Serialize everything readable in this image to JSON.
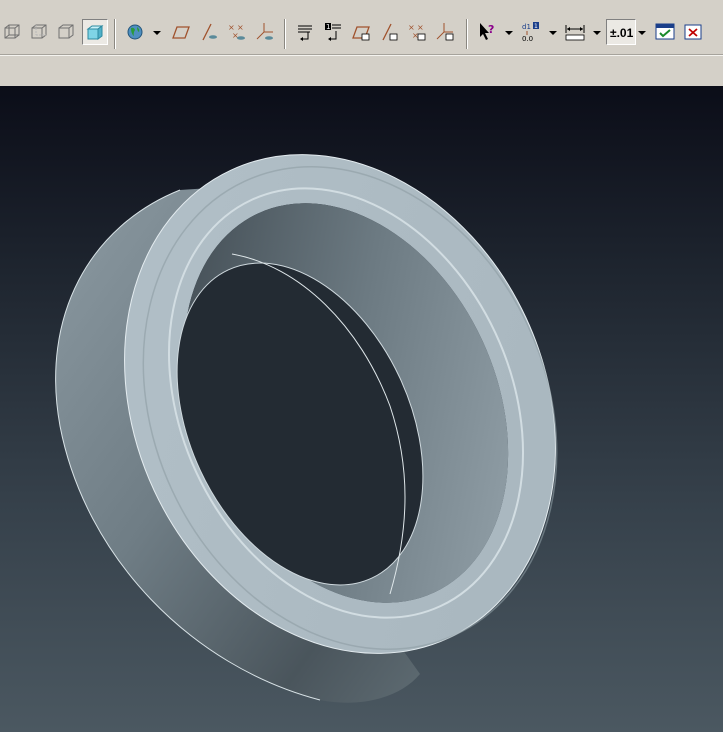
{
  "toolbar": {
    "groups": [
      {
        "name": "view-display-style",
        "buttons": [
          "wireframe",
          "hidden-line",
          "no-hidden",
          "shaded"
        ]
      },
      {
        "name": "datum-display",
        "buttons": [
          "spin-center",
          "datum-planes",
          "datum-axes",
          "datum-points",
          "coordinate-systems"
        ]
      },
      {
        "name": "annotation-display",
        "buttons": [
          "notes",
          "note-numbers",
          "annotation-planes",
          "annotation-axes",
          "annotation-points",
          "annotation-csys"
        ]
      },
      {
        "name": "tools",
        "buttons": [
          "whats-this",
          "dimension-switch",
          "measure",
          "tolerance",
          "window-activate",
          "close-window"
        ]
      }
    ],
    "tolerance_label": "±.01",
    "active_button": "shaded"
  },
  "viewport": {
    "background_top": "#0b0d18",
    "background_bottom": "#4b5861",
    "model": "ring",
    "model_color": "#aebcc4"
  }
}
